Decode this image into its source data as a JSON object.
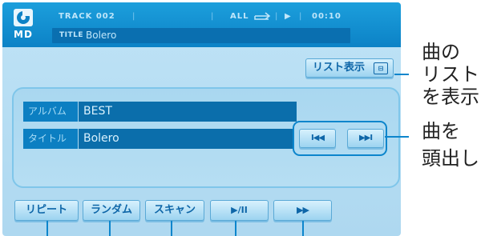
{
  "header": {
    "md_label": "MD",
    "track_label": "TRACK 002",
    "repeat_mode": "ALL",
    "play_indicator": "▶",
    "time": "00:10",
    "title_label": "TITLE",
    "title_value": "Bolero",
    "icon": "disc-icon"
  },
  "list_button": {
    "label": "リスト表示",
    "icon": "list-icon",
    "icon_glyph": "⊟"
  },
  "fields": {
    "album": {
      "label": "アルバム",
      "value": "BEST"
    },
    "title": {
      "label": "タイトル",
      "value": "Bolero"
    }
  },
  "skip": {
    "prev_glyph": "I◀◀",
    "next_glyph": "▶▶I"
  },
  "bottom_buttons": {
    "repeat": "リピート",
    "random": "ランダム",
    "scan": "スキャン",
    "play_pause": "▶/II",
    "fast_forward": "▶▶"
  },
  "callouts": {
    "list_line1": "曲の",
    "list_line2": "リスト",
    "list_line3": "を表示",
    "skip_line1": "曲を",
    "skip_line2": "頭出し"
  },
  "colors": {
    "screen_bg": "#b6def3",
    "header_bg": "#1596d6",
    "field_bg": "#0c7fc2",
    "button_text": "#0e66a8",
    "callout_line": "#0c85cc"
  }
}
